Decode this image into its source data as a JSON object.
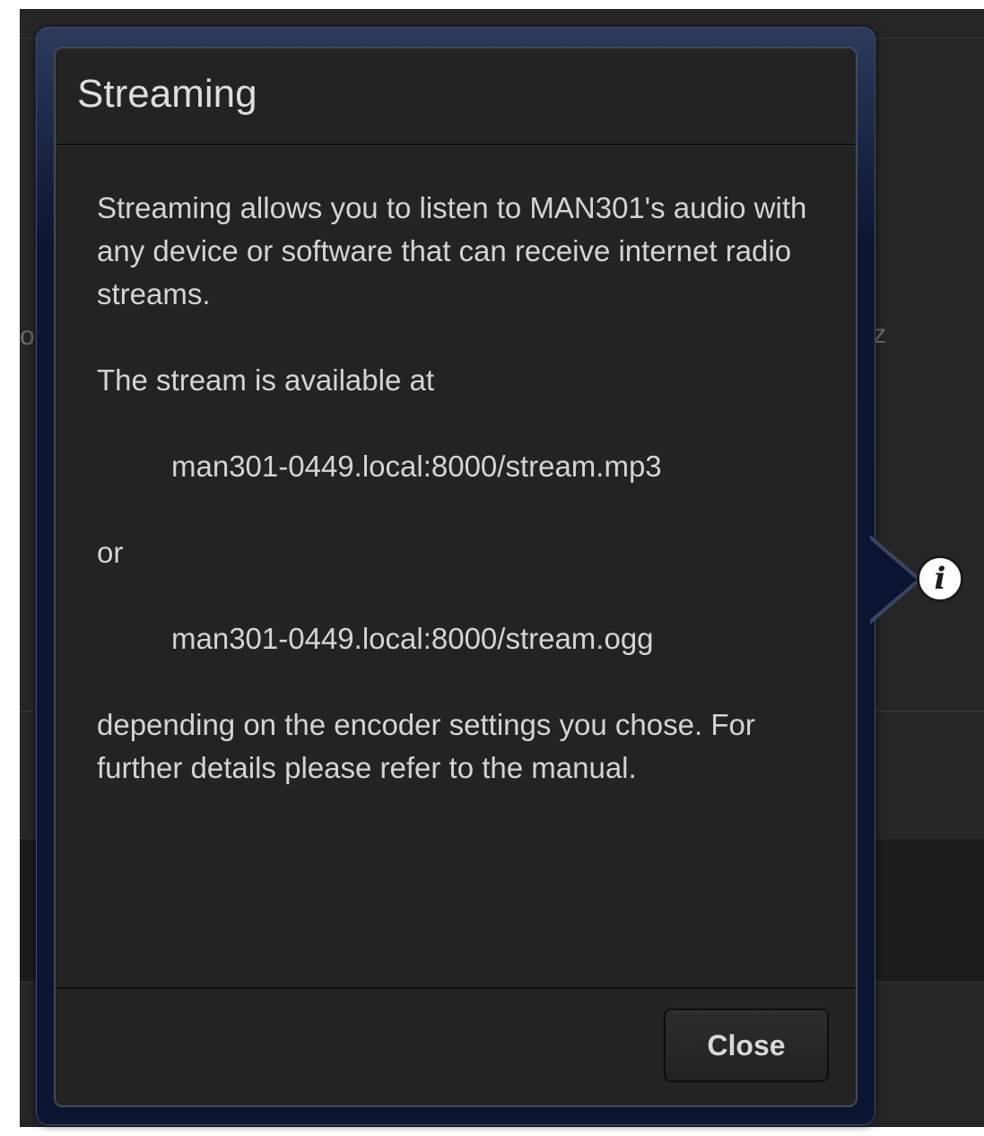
{
  "background": {
    "left_glyph": "o",
    "right_glyph": "z"
  },
  "modal": {
    "title": "Streaming",
    "paragraphs": [
      "Streaming allows you to listen to MAN301's audio with any device or software that can receive internet radio streams.",
      "The stream is available at",
      "man301-0449.local:8000/stream.mp3",
      "or",
      "man301-0449.local:8000/stream.ogg",
      "depending on the encoder settings you chose. For further details please refer to the manual."
    ],
    "close_label": "Close"
  },
  "info_icon": {
    "glyph": "i",
    "name": "info-icon"
  },
  "colors": {
    "modal_bg": "#232323",
    "glow": "#0b1430",
    "text": "#d4d4d4"
  }
}
